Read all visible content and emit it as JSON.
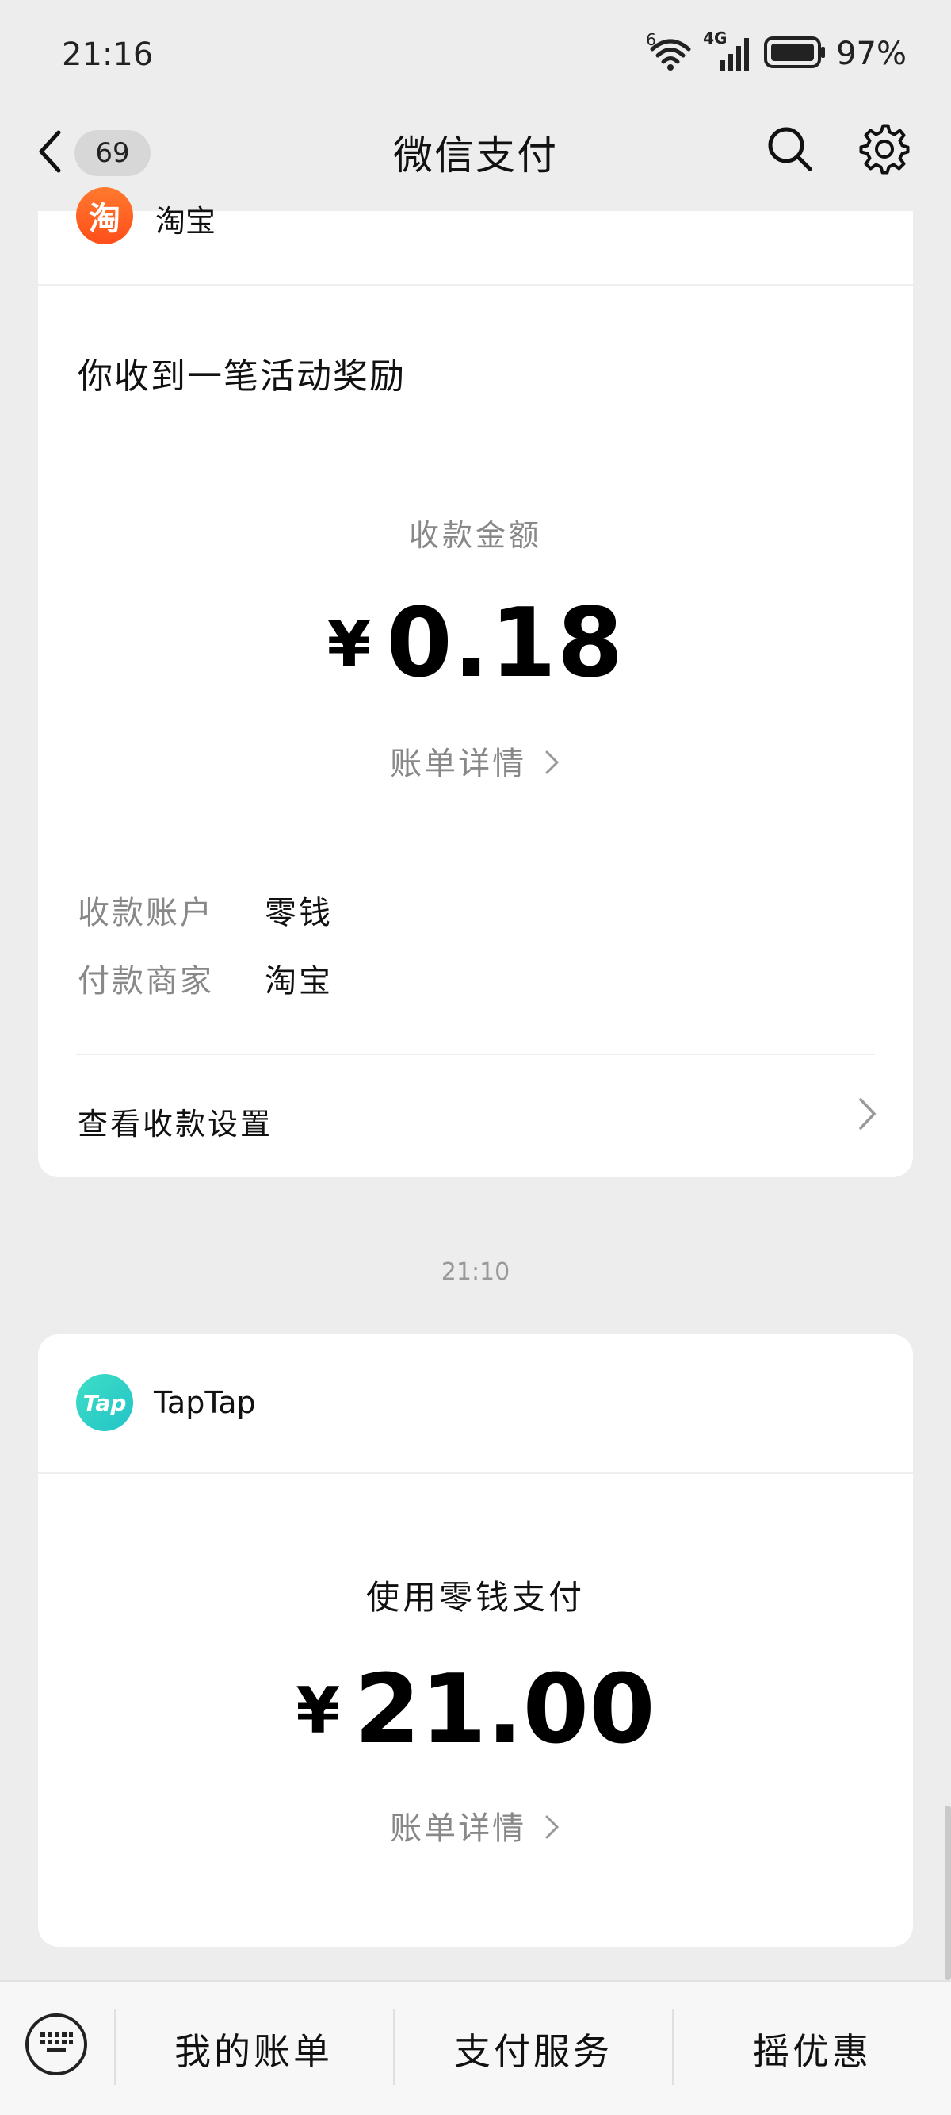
{
  "status_bar": {
    "time": "21:16",
    "network": "4G",
    "wifi_badge": "6",
    "battery_percent": "97%"
  },
  "header": {
    "title": "微信支付",
    "unread_badge": "69",
    "icons": [
      "back-arrow-icon",
      "search-icon",
      "settings-gear-icon"
    ]
  },
  "card1": {
    "merchant_name": "淘宝",
    "merchant_logo_char": "淘",
    "title": "你收到一笔活动奖励",
    "amount_label": "收款金额",
    "currency": "¥",
    "amount": "0.18",
    "bill_details": "账单详情",
    "details": [
      {
        "label": "收款账户",
        "value": "零钱"
      },
      {
        "label": "付款商家",
        "value": "淘宝"
      }
    ],
    "settings_link": "查看收款设置"
  },
  "timestamp": "21:10",
  "card2": {
    "merchant_name": "TapTap",
    "merchant_logo_text": "Tap",
    "payment_method": "使用零钱支付",
    "currency": "¥",
    "amount": "21.00",
    "bill_details": "账单详情"
  },
  "bottom_bar": {
    "tabs": [
      "我的账单",
      "支付服务",
      "摇优惠"
    ],
    "keyboard_icon": "keyboard-icon"
  },
  "colors": {
    "background": "#ededed",
    "card": "#ffffff",
    "taobao_orange": "#ff5a1f",
    "taptap_teal": "#2cd0c6",
    "muted_text": "#888888"
  }
}
